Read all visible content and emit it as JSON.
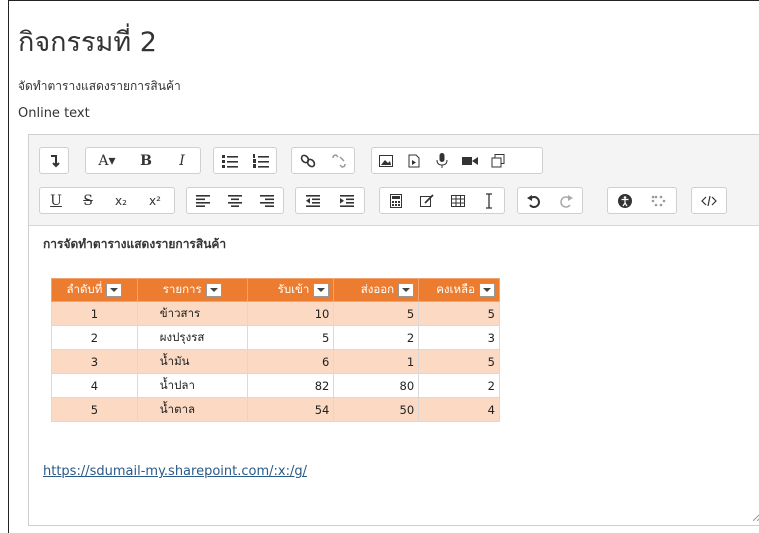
{
  "page": {
    "title": "กิจกรรมที่ 2",
    "description": "จัดทำตารางแสดงรายการสินค้า",
    "online_text_label": "Online text"
  },
  "toolbar": {
    "font_size_label": "A▾",
    "bold_label": "B",
    "italic_label": "I",
    "underline_label": "U",
    "strike_label": "S",
    "subscript_label": "x₂",
    "superscript_label": "x²"
  },
  "editor": {
    "heading": "การจัดทำตารางแสดงรายการสินค้า",
    "table": {
      "headers": [
        "ลำดับที่",
        "รายการ",
        "รับเข้า",
        "ส่งออก",
        "คงเหลือ"
      ],
      "rows": [
        [
          "1",
          "ข้าวสาร",
          "10",
          "5",
          "5"
        ],
        [
          "2",
          "ผงปรุงรส",
          "5",
          "2",
          "3"
        ],
        [
          "3",
          "น้ำมัน",
          "6",
          "1",
          "5"
        ],
        [
          "4",
          "น้ำปลา",
          "82",
          "80",
          "2"
        ],
        [
          "5",
          "น้ำตาล",
          "54",
          "50",
          "4"
        ]
      ]
    },
    "link_text": "https://sdumail-my.sharepoint.com/:x:/g/"
  }
}
